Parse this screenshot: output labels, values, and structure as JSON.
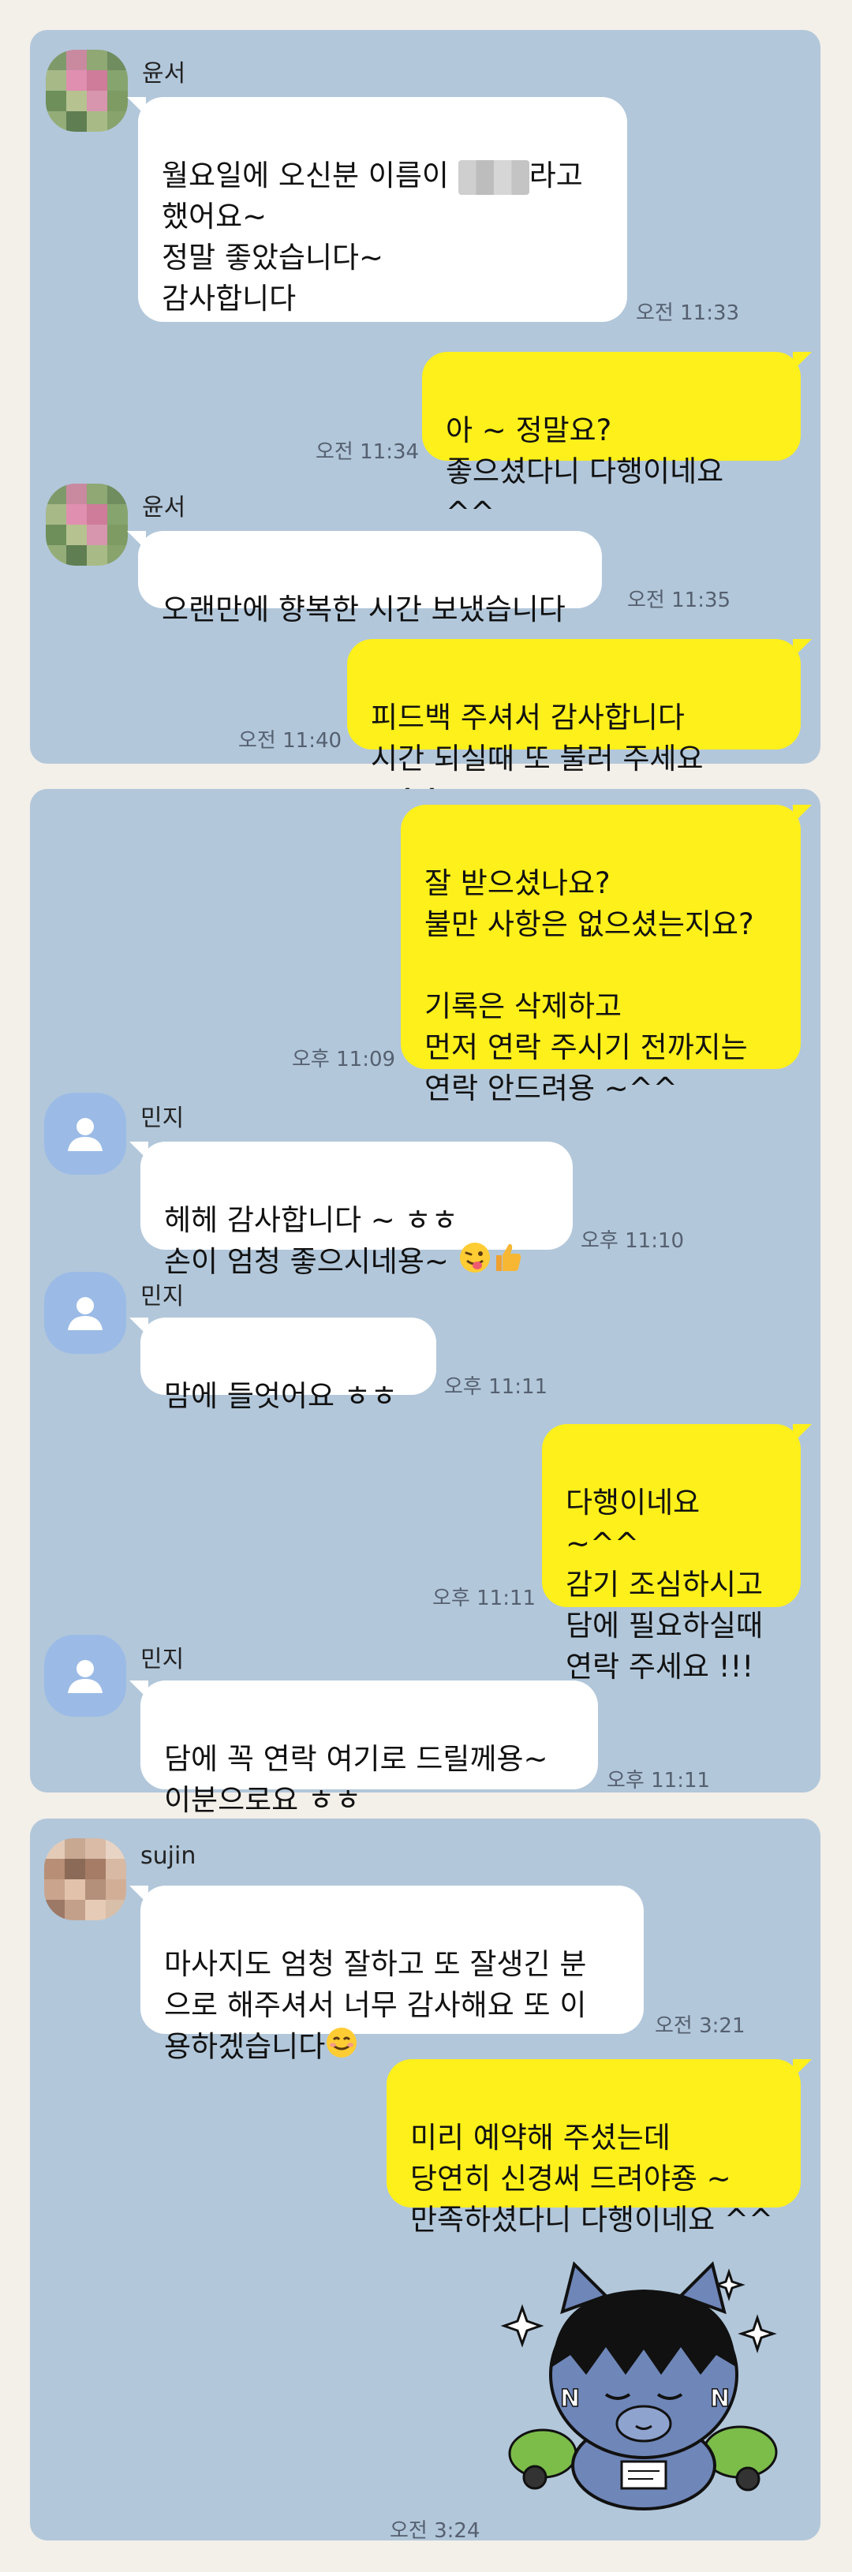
{
  "panel1": {
    "msg1": {
      "sender": "윤서",
      "text_a": "월요일에 오신분 이름이 ",
      "text_b": "라고\n했어요~\n정말 좋았습니다~\n감사합니다",
      "time": "오전 11:33"
    },
    "msg2": {
      "text": "아 ~ 정말요?\n좋으셨다니 다행이네요 ^^",
      "time": "오전 11:34"
    },
    "msg3": {
      "sender": "윤서",
      "text": "오랜만에 향복한 시간 보냈습니다",
      "time": "오전 11:35"
    },
    "msg4": {
      "text": "피드백 주셔서 감사합니다\n시간 되실때 또 불러 주세요 ~^^",
      "time": "오전 11:40"
    }
  },
  "panel2": {
    "msg1": {
      "text": "잘 받으셨나요?\n불만 사항은 없으셨는지요?\n\n기록은 삭제하고\n먼저 연락 주시기 전까지는\n연락 안드려용 ~^^",
      "time": "오후 11:09"
    },
    "msg2": {
      "sender": "민지",
      "text_a": "헤헤 감사합니다 ~ ㅎㅎ",
      "text_b": "손이 엄청 좋으시네용~ ",
      "time": "오후 11:10"
    },
    "msg3": {
      "sender": "민지",
      "text": "맘에 들엇어요 ㅎㅎ",
      "time": "오후 11:11"
    },
    "msg4": {
      "text": "다행이네요 ~^^\n감기 조심하시고\n담에 필요하실때\n연락 주세요 !!!",
      "time": "오후 11:11"
    },
    "msg5": {
      "sender": "민지",
      "text": "담에 꼭 연락 여기로 드릴께용~\n이분으로요 ㅎㅎ",
      "time": "오후 11:11"
    }
  },
  "panel3": {
    "msg1": {
      "sender": "sujin",
      "text": "마사지도 엄청 잘하고 또 잘생긴 분\n으로 해주셔서 너무 감사해요 또 이\n용하겠습니다",
      "time": "오전 3:21"
    },
    "msg2": {
      "text": "미리 예약해 주셨는데\n당연히 신경써 드려야죵 ~\n만족하셨다니 다행이네요 ^^"
    },
    "sticker_time": "오전 3:24"
  },
  "colors": {
    "chat_bg": "#b2c7da",
    "outgoing_bubble": "#fef01b",
    "incoming_bubble": "#ffffff",
    "page_bg": "#f3efe9"
  },
  "icons": [
    "default-profile-icon",
    "winking-tongue-emoji",
    "thumbs-up-emoji",
    "smiling-emoji",
    "character-sticker"
  ]
}
